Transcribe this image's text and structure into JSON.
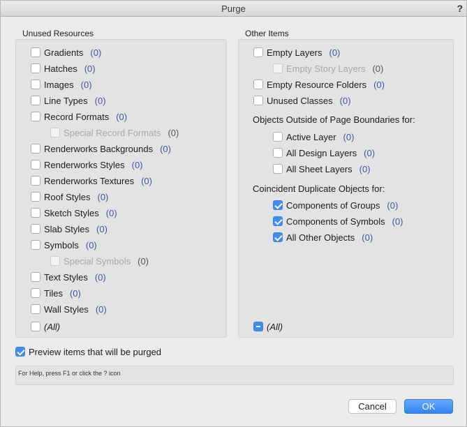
{
  "window": {
    "title": "Purge",
    "help_glyph": "?"
  },
  "left": {
    "title": "Unused Resources",
    "items": [
      {
        "label": "Gradients",
        "count": "(0)"
      },
      {
        "label": "Hatches",
        "count": "(0)"
      },
      {
        "label": "Images",
        "count": "(0)"
      },
      {
        "label": "Line Types",
        "count": "(0)"
      },
      {
        "label": "Record Formats",
        "count": "(0)"
      },
      {
        "label": "Special Record Formats",
        "count": "(0)"
      },
      {
        "label": "Renderworks Backgrounds",
        "count": "(0)"
      },
      {
        "label": "Renderworks Styles",
        "count": "(0)"
      },
      {
        "label": "Renderworks Textures",
        "count": "(0)"
      },
      {
        "label": "Roof Styles",
        "count": "(0)"
      },
      {
        "label": "Sketch Styles",
        "count": "(0)"
      },
      {
        "label": "Slab Styles",
        "count": "(0)"
      },
      {
        "label": "Symbols",
        "count": "(0)"
      },
      {
        "label": "Special Symbols",
        "count": "(0)"
      },
      {
        "label": "Text Styles",
        "count": "(0)"
      },
      {
        "label": "Tiles",
        "count": "(0)"
      },
      {
        "label": "Wall Styles",
        "count": "(0)"
      },
      {
        "label": "(All)"
      }
    ]
  },
  "right": {
    "title": "Other Items",
    "items": [
      {
        "label": "Empty Layers",
        "count": "(0)"
      },
      {
        "label": "Empty Story Layers",
        "count": "(0)"
      },
      {
        "label": "Empty Resource Folders",
        "count": "(0)"
      },
      {
        "label": "Unused Classes",
        "count": "(0)"
      }
    ],
    "outside_heading": "Objects Outside of Page Boundaries for:",
    "outside_items": [
      {
        "label": "Active Layer",
        "count": "(0)"
      },
      {
        "label": "All Design Layers",
        "count": "(0)"
      },
      {
        "label": "All Sheet Layers",
        "count": "(0)"
      }
    ],
    "coincident_heading": "Coincident Duplicate Objects for:",
    "coincident_items": [
      {
        "label": "Components of Groups",
        "count": "(0)"
      },
      {
        "label": "Components of Symbols",
        "count": "(0)"
      },
      {
        "label": "All Other Objects",
        "count": "(0)"
      }
    ],
    "all_label": "(All)"
  },
  "preview": {
    "label": "Preview items that will be purged"
  },
  "status": {
    "text": "For Help, press F1 or click the ? icon"
  },
  "buttons": {
    "cancel": "Cancel",
    "ok": "OK"
  }
}
